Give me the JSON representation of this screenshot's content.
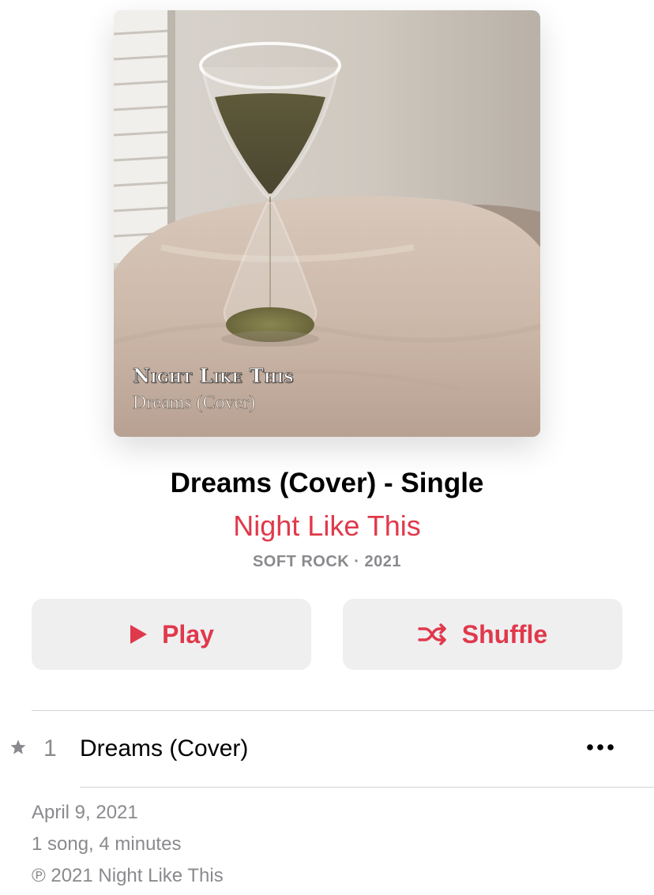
{
  "artwork": {
    "artist_overlay": "Night Like This",
    "title_overlay": "Dreams (Cover)"
  },
  "album": {
    "title": "Dreams (Cover) - Single",
    "artist": "Night Like This",
    "meta": "SOFT ROCK · 2021"
  },
  "buttons": {
    "play_label": "Play",
    "shuffle_label": "Shuffle",
    "play_icon": "play-icon",
    "shuffle_icon": "shuffle-icon"
  },
  "tracks": [
    {
      "number": "1",
      "title": "Dreams (Cover)",
      "starred": true,
      "more_icon": "ellipsis-icon"
    }
  ],
  "info": {
    "release_date": "April 9, 2021",
    "summary": "1 song, 4 minutes",
    "copyright": "℗ 2021 Night Like This"
  },
  "colors": {
    "accent": "#e0394b",
    "secondary_text": "#8a8a8e",
    "button_bg": "#efeff0",
    "divider": "#d1d1d6"
  }
}
